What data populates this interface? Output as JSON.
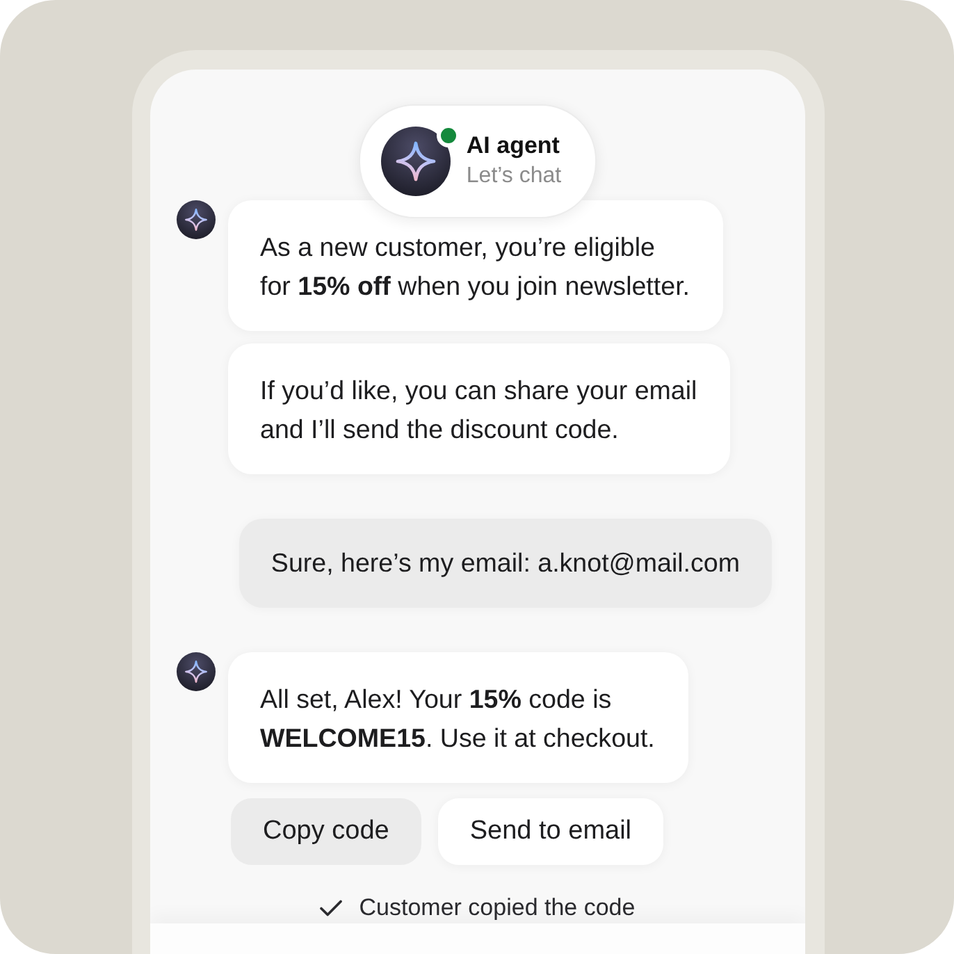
{
  "header": {
    "title": "AI agent",
    "subtitle": "Let’s chat",
    "online": true
  },
  "messages": [
    {
      "kind": "agent",
      "show_avatar": true,
      "text": "As a new customer, you’re eligible\nfor **15% off** when you join newsletter."
    },
    {
      "kind": "agent",
      "show_avatar": false,
      "text": "If you’d like, you can share your email\nand I’ll send the discount code."
    },
    {
      "kind": "user",
      "text": "Sure, here’s my email: a.knot@mail.com"
    },
    {
      "kind": "agent",
      "show_avatar": true,
      "text": "All set, Alex! Your **15%** code is\n**WELCOME15**. Use it at checkout."
    }
  ],
  "actions": [
    {
      "label": "Copy code",
      "selected": true
    },
    {
      "label": "Send to email",
      "selected": false
    }
  ],
  "status": {
    "text": "Customer copied the code",
    "checked": true
  }
}
